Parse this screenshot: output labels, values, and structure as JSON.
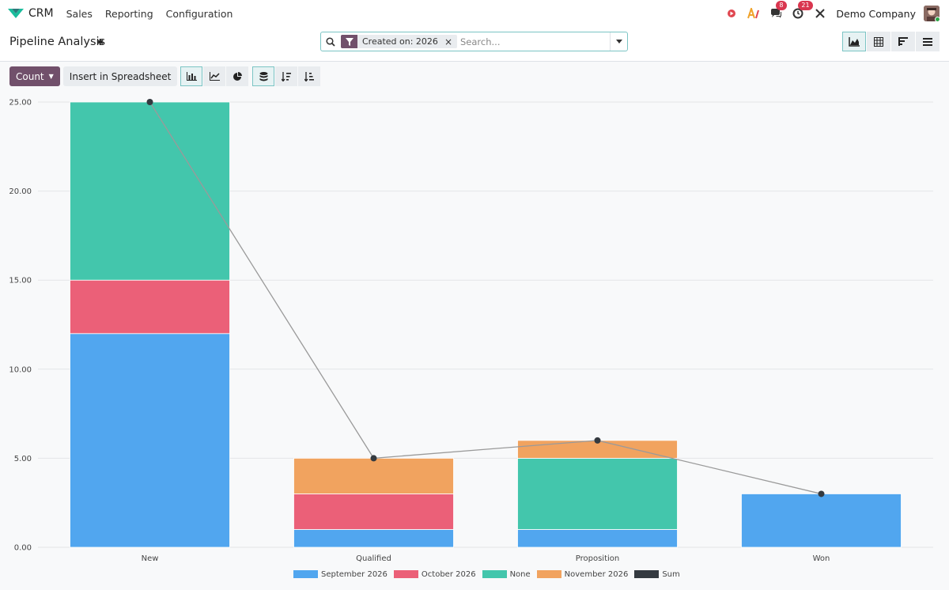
{
  "navbar": {
    "app_name": "CRM",
    "menus": [
      "Sales",
      "Reporting",
      "Configuration"
    ],
    "messages_count": "8",
    "activities_count": "21",
    "company": "Demo Company"
  },
  "control": {
    "title": "Pipeline Analysis",
    "facet_label": "Created on: 2026",
    "search_placeholder": "Search..."
  },
  "toolbar": {
    "measure_label": "Count",
    "insert_label": "Insert in Spreadsheet"
  },
  "colors": {
    "brand": "#71506b",
    "September 2026": "#51a6ef",
    "October 2026": "#eb6078",
    "None": "#43c6ac",
    "November 2026": "#f1a35f",
    "Sum": "#343a40"
  },
  "chart_data": {
    "type": "bar",
    "stacked": true,
    "categories": [
      "New",
      "Qualified",
      "Proposition",
      "Won"
    ],
    "series": [
      {
        "name": "September 2026",
        "values": [
          12,
          1,
          1,
          3
        ]
      },
      {
        "name": "October 2026",
        "values": [
          3,
          2,
          0,
          0
        ]
      },
      {
        "name": "None",
        "values": [
          10,
          0,
          4,
          0
        ]
      },
      {
        "name": "November 2026",
        "values": [
          0,
          2,
          1,
          0
        ]
      }
    ],
    "line": {
      "name": "Sum",
      "values": [
        25,
        5,
        6,
        3
      ]
    },
    "ylim": [
      0,
      25
    ],
    "yticks": [
      "0.00",
      "5.00",
      "10.00",
      "15.00",
      "20.00",
      "25.00"
    ],
    "grid": true,
    "legend_position": "bottom"
  }
}
